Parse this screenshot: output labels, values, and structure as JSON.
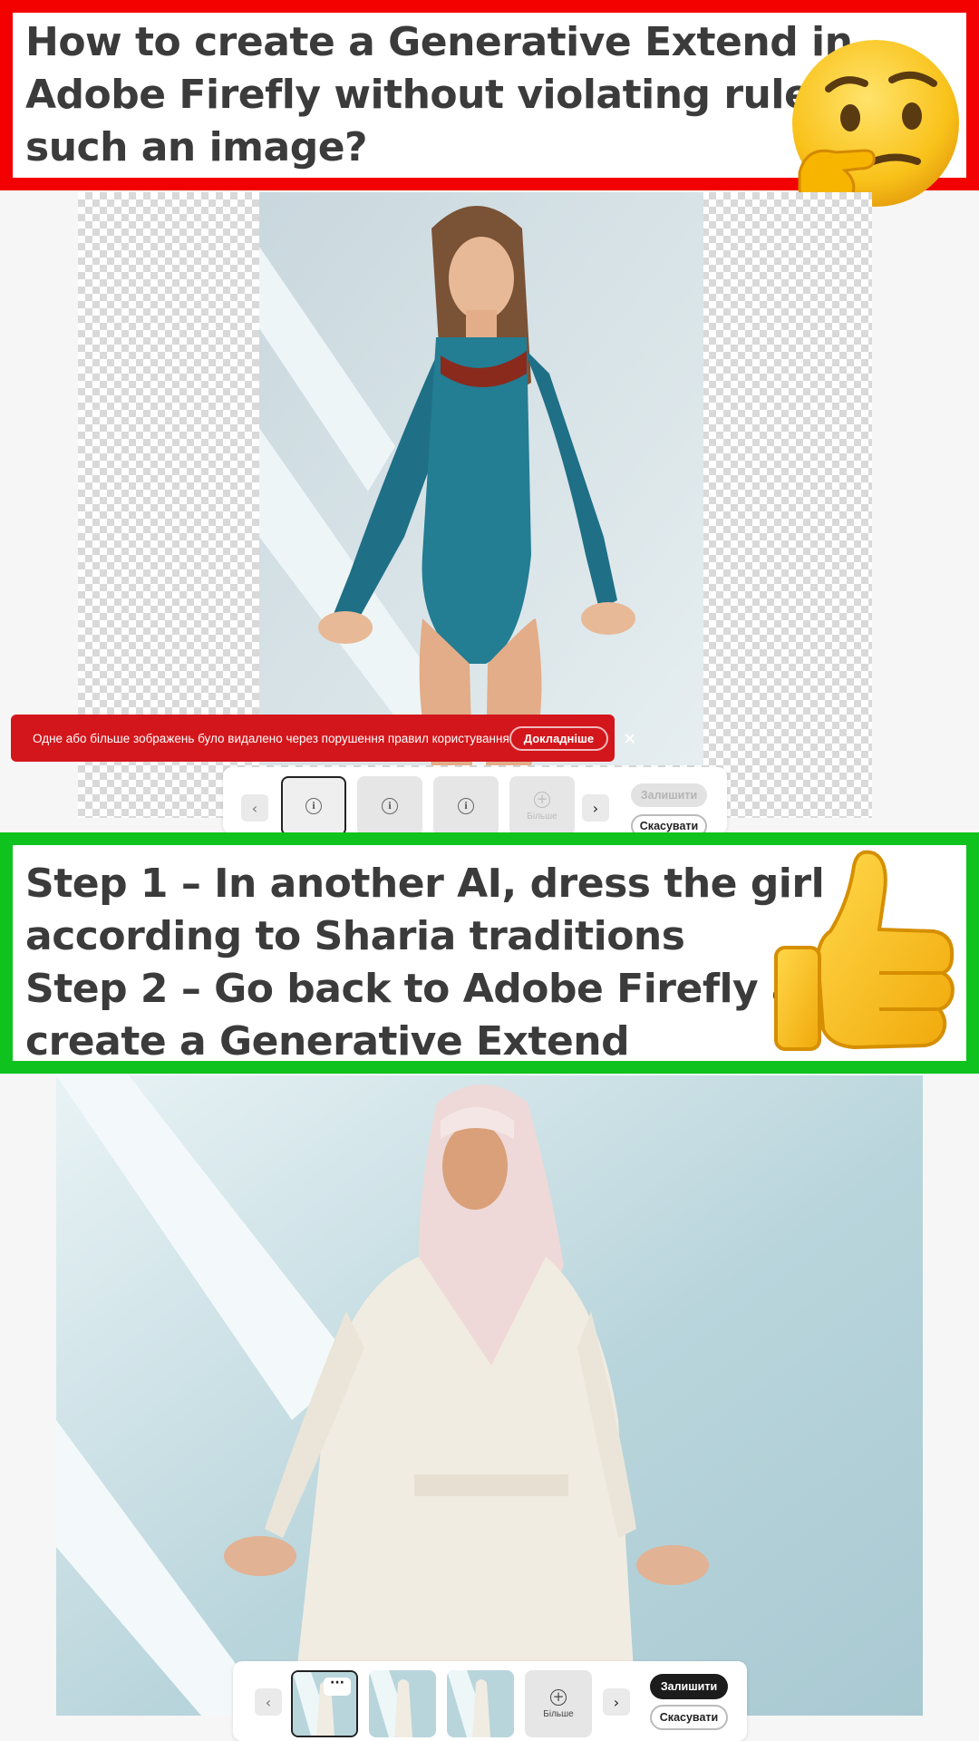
{
  "top_banner": {
    "lines": [
      "How to create a Generative Extend in",
      "Adobe Firefly without violating rules on",
      "such an image?"
    ],
    "border_color": "#f30000",
    "emoji": "thinking-face"
  },
  "error_toast": {
    "message": "Одне або більше зображень було видалено через порушення правил користування",
    "details_button": "Докладніше",
    "close_icon": "×",
    "color": "#d3161b"
  },
  "toolbar_1": {
    "prev": "‹",
    "next": "›",
    "more_label": "Більше",
    "keep_label": "Залишити",
    "cancel_label": "Скасувати",
    "info_glyph": "i"
  },
  "bottom_banner": {
    "lines": [
      "Step 1 – In another AI, dress the girl",
      "according to Sharia traditions",
      "Step 2 – Go back to Adobe Firefly and",
      "create a Generative Extend"
    ],
    "border_color": "#0fc21d",
    "emoji": "thumbs-up"
  },
  "toolbar_2": {
    "prev": "‹",
    "next": "›",
    "more_label": "Більше",
    "keep_label": "Залишити",
    "cancel_label": "Скасувати",
    "options_glyph": "···"
  }
}
